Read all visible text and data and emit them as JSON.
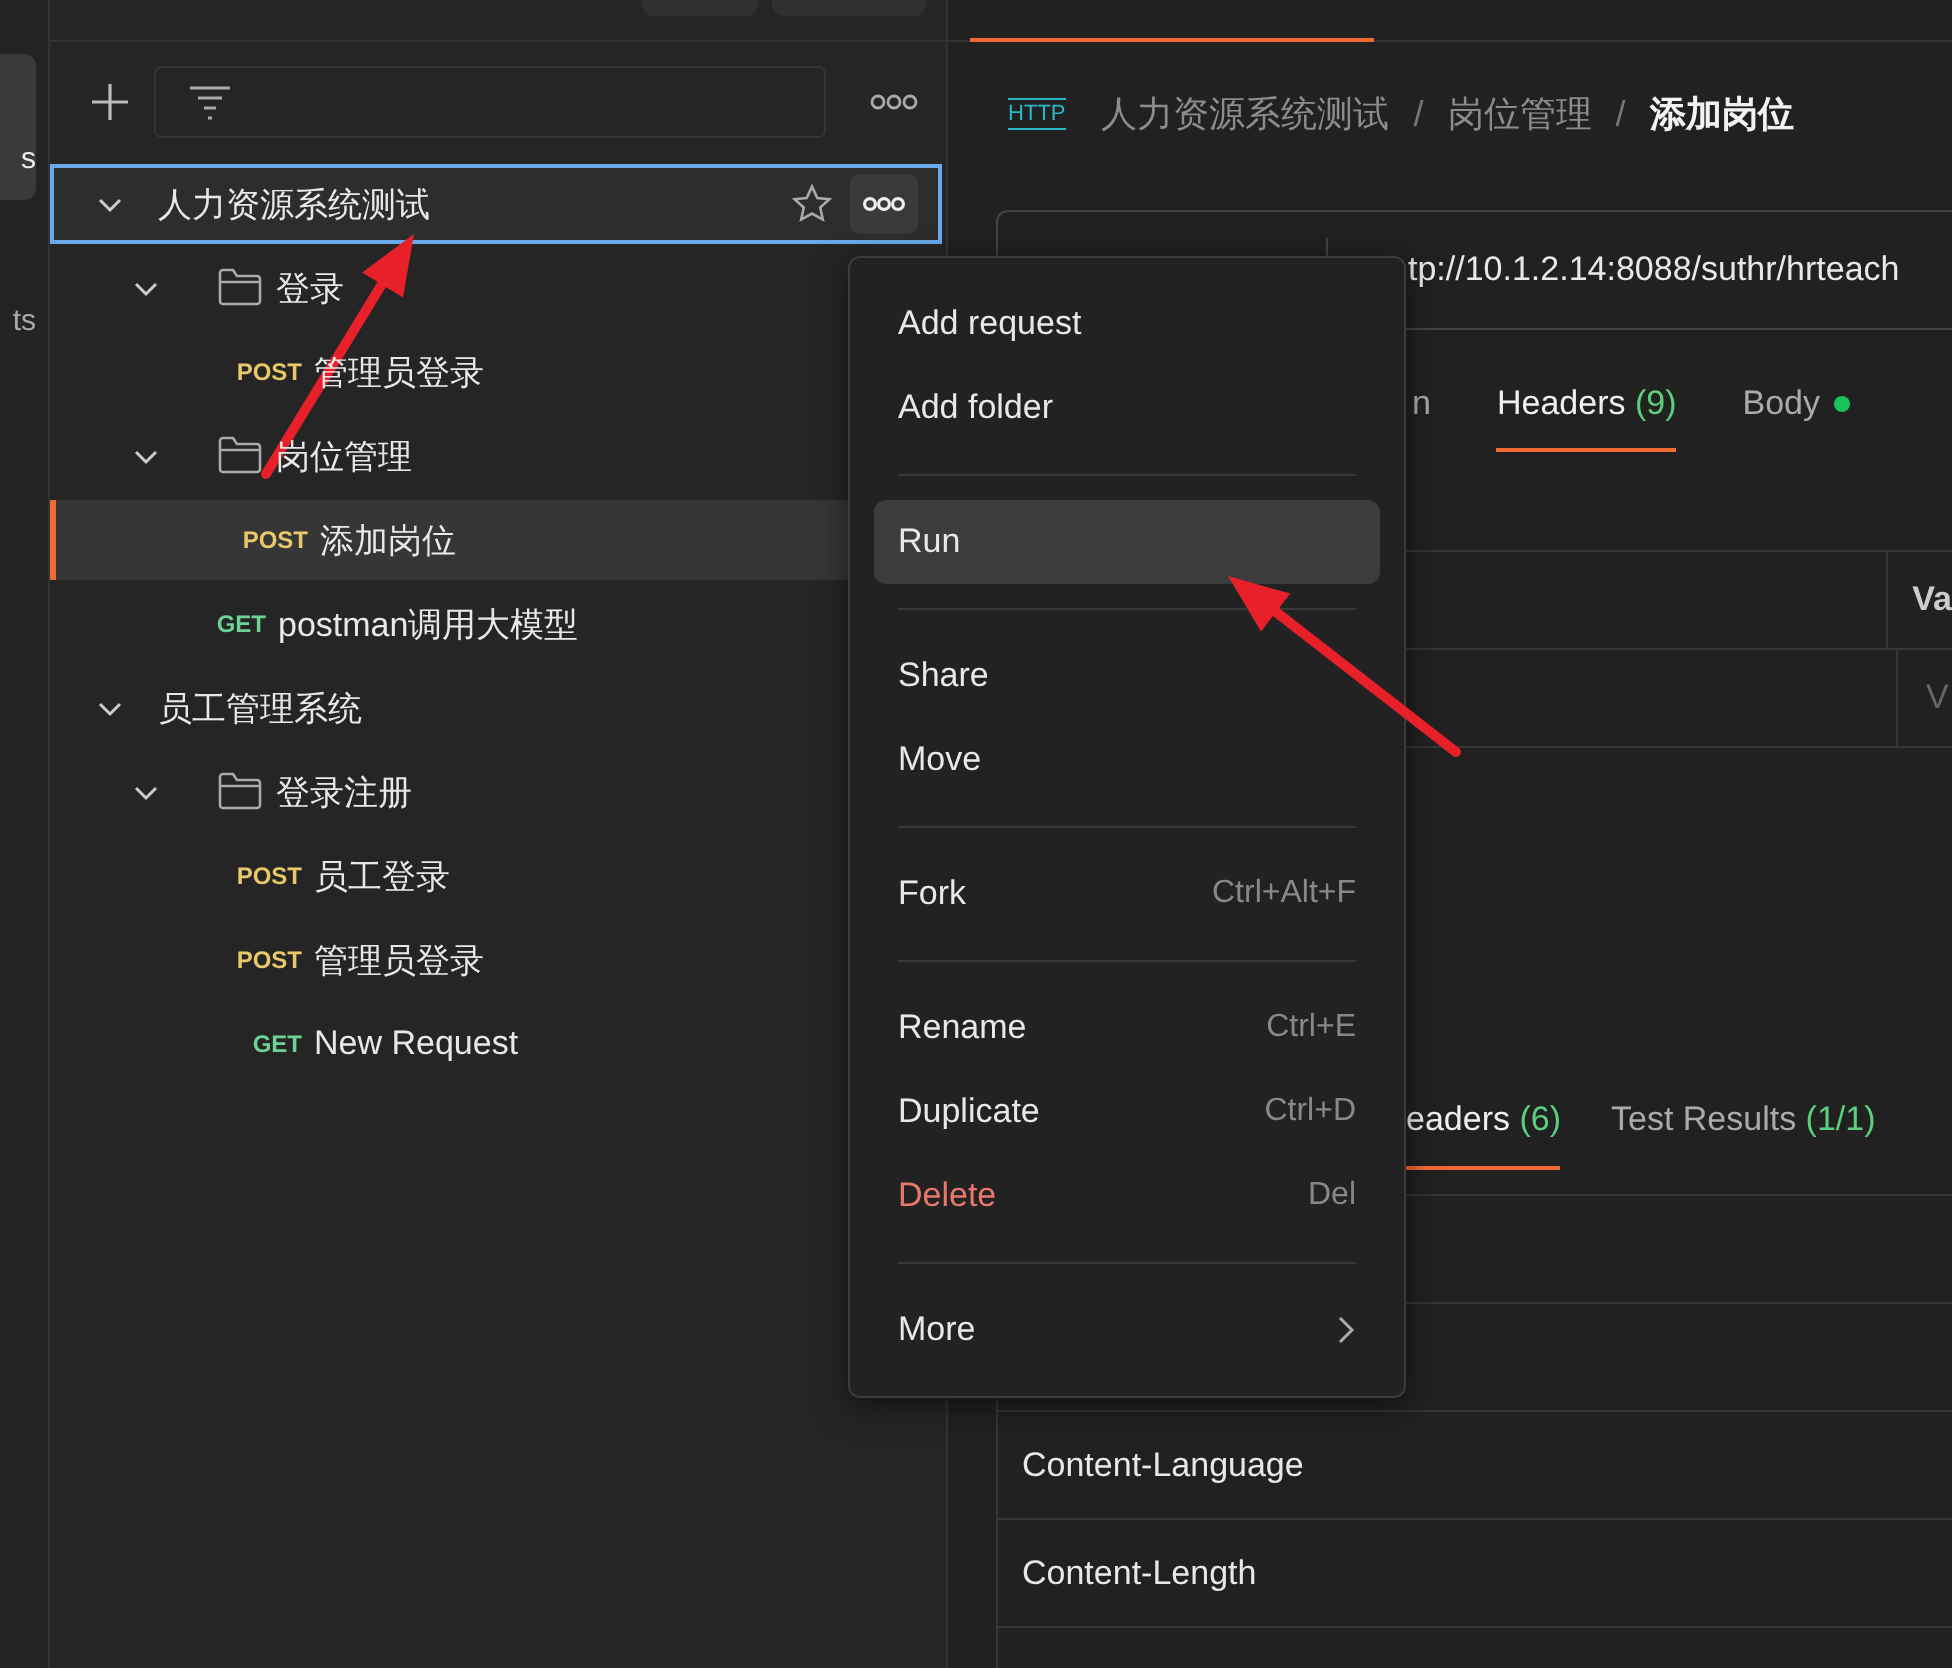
{
  "rail": {
    "items": [
      {
        "label": "s",
        "selected": true
      },
      {
        "label": "ts",
        "selected": false
      }
    ]
  },
  "sidebar": {
    "tree": [
      {
        "kind": "collection",
        "label": "人力资源系统测试",
        "expanded": true,
        "selected": true,
        "active": false,
        "children": [
          {
            "kind": "folder",
            "label": "登录",
            "expanded": true,
            "selected": false,
            "active": false,
            "children": [
              {
                "kind": "request",
                "method": "POST",
                "color": "#e8c868",
                "label": "管理员登录",
                "selected": false,
                "active": false
              }
            ]
          },
          {
            "kind": "folder",
            "label": "岗位管理",
            "expanded": true,
            "selected": false,
            "active": false,
            "children": [
              {
                "kind": "request",
                "method": "POST",
                "color": "#e8c868",
                "label": "添加岗位",
                "selected": false,
                "active": true
              }
            ]
          },
          {
            "kind": "request",
            "method": "GET",
            "color": "#6bd393",
            "label": "postman调用大模型",
            "selected": false,
            "active": false
          }
        ]
      },
      {
        "kind": "collection",
        "label": "员工管理系统",
        "expanded": true,
        "selected": false,
        "active": false,
        "children": [
          {
            "kind": "folder",
            "label": "登录注册",
            "expanded": true,
            "selected": false,
            "active": false,
            "children": [
              {
                "kind": "request",
                "method": "POST",
                "color": "#e8c868",
                "label": "员工登录",
                "selected": false,
                "active": false
              },
              {
                "kind": "request",
                "method": "POST",
                "color": "#e8c868",
                "label": "管理员登录",
                "selected": false,
                "active": false
              },
              {
                "kind": "request",
                "method": "GET",
                "color": "#6bd393",
                "label": "New Request",
                "selected": false,
                "active": false
              }
            ]
          }
        ]
      }
    ]
  },
  "request": {
    "protocol": "HTTP",
    "breadcrumb": [
      {
        "kind": "segment",
        "text": "人力资源系统测试",
        "selected": false
      },
      {
        "kind": "separator",
        "text": "/"
      },
      {
        "kind": "segment",
        "text": "岗位管理",
        "selected": false
      },
      {
        "kind": "separator",
        "text": "/"
      },
      {
        "kind": "segment",
        "text": "添加岗位",
        "selected": true
      }
    ],
    "url": "tp://10.1.2.14:8088/suthr/hrteach",
    "tabs": [
      {
        "label": "n",
        "selected": false,
        "dot": false
      },
      {
        "label": "Headers",
        "count": "(9)",
        "selected": true,
        "dot": false
      },
      {
        "label": "Body",
        "selected": false,
        "dot": true
      }
    ],
    "table": {
      "columns": [
        "Va"
      ],
      "placeholder": "V"
    }
  },
  "response": {
    "tabs": [
      {
        "label": "eaders",
        "count": "(6)",
        "selected": true
      },
      {
        "label": "Test Results",
        "count": "(1/1)",
        "selected": false
      }
    ],
    "rows": [
      {
        "key": "Content-Language"
      },
      {
        "key": "Content-Length"
      }
    ]
  },
  "context_menu": {
    "groups": [
      [
        {
          "label": "Add request",
          "selected": false,
          "destructive": false,
          "submenu": false
        },
        {
          "label": "Add folder",
          "selected": false,
          "destructive": false,
          "submenu": false
        }
      ],
      [
        {
          "label": "Run",
          "selected": true,
          "destructive": false,
          "submenu": false
        }
      ],
      [
        {
          "label": "Share",
          "selected": false,
          "destructive": false,
          "submenu": false
        },
        {
          "label": "Move",
          "selected": false,
          "destructive": false,
          "submenu": false
        }
      ],
      [
        {
          "label": "Fork",
          "shortcut": "Ctrl+Alt+F",
          "selected": false,
          "destructive": false,
          "submenu": false
        }
      ],
      [
        {
          "label": "Rename",
          "shortcut": "Ctrl+E",
          "selected": false,
          "destructive": false,
          "submenu": false
        },
        {
          "label": "Duplicate",
          "shortcut": "Ctrl+D",
          "selected": false,
          "destructive": false,
          "submenu": false
        },
        {
          "label": "Delete",
          "shortcut": "Del",
          "selected": false,
          "destructive": true,
          "submenu": false
        }
      ],
      [
        {
          "label": "More",
          "selected": false,
          "destructive": false,
          "submenu": true
        }
      ]
    ]
  }
}
